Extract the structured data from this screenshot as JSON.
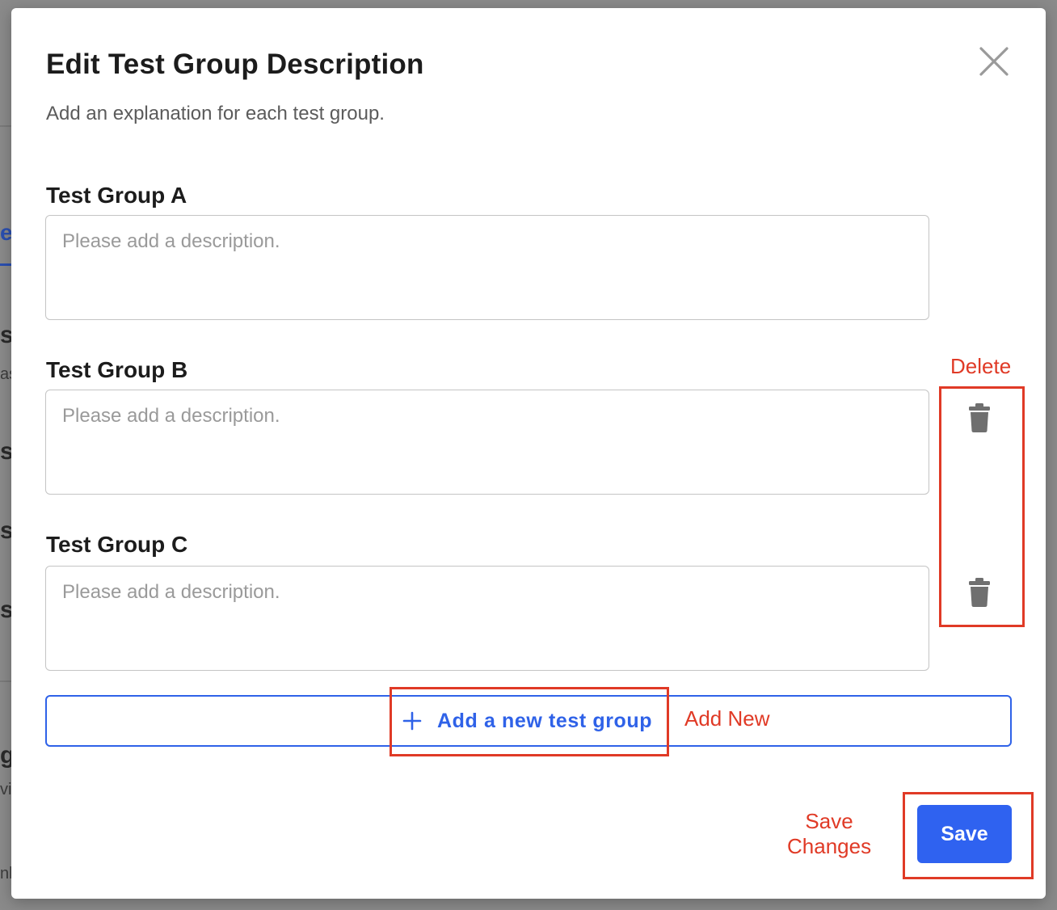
{
  "background": {
    "fragments": [
      "e",
      "s",
      "as",
      "st",
      "st",
      "st",
      "g",
      "vi",
      "nl"
    ]
  },
  "modal": {
    "title": "Edit Test Group Description",
    "subtitle": "Add an explanation for each test group.",
    "close_icon": "close-icon",
    "groups": [
      {
        "label": "Test Group A",
        "placeholder": "Please add a description.",
        "value": "",
        "deletable": false
      },
      {
        "label": "Test Group B",
        "placeholder": "Please add a description.",
        "value": "",
        "deletable": true
      },
      {
        "label": "Test Group C",
        "placeholder": "Please add a description.",
        "value": "",
        "deletable": true
      }
    ],
    "add_button_label": "Add a new test group",
    "add_icon": "plus-icon",
    "delete_icon": "trash-icon",
    "save_label": "Save"
  },
  "annotations": {
    "delete_label": "Delete",
    "add_new_label": "Add New",
    "save_changes_label": "Save\nChanges"
  },
  "colors": {
    "accent": "#2f62e8",
    "annotation": "#e03a26",
    "overlay": "#8a8a8a"
  }
}
